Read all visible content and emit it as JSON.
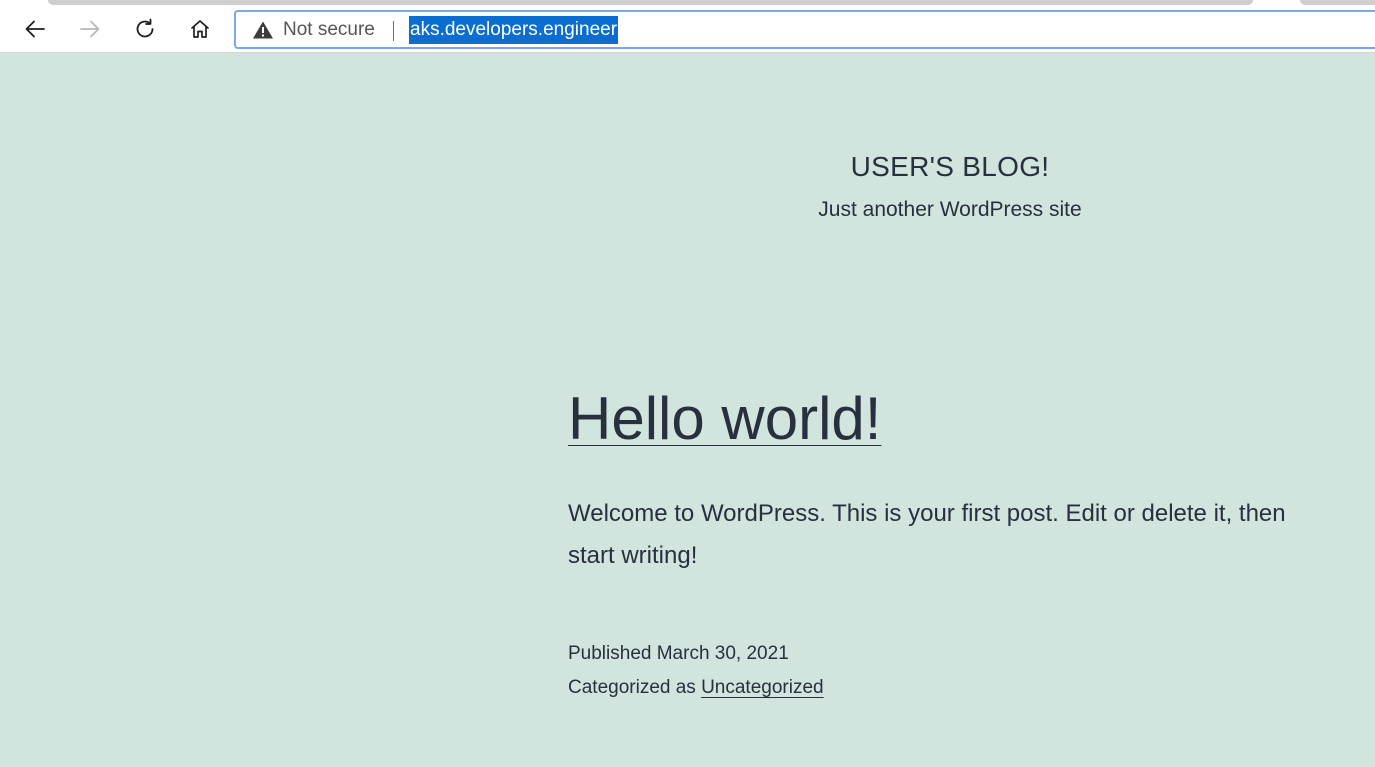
{
  "browser": {
    "back_icon": "arrow-left-icon",
    "forward_icon": "arrow-right-icon",
    "reload_icon": "reload-icon",
    "home_icon": "home-icon",
    "security_icon": "warning-triangle-icon",
    "security_label": "Not secure",
    "url": "aks.developers.engineer",
    "url_selected": true,
    "selection_color": "#0a6ed1",
    "focus_ring_color": "#7aa7e6"
  },
  "site": {
    "title": "USER'S BLOG!",
    "description": "Just another WordPress site",
    "background_color": "#d1e4dd",
    "text_color": "#28303d"
  },
  "post": {
    "title": "Hello world!",
    "excerpt": "Welcome to WordPress. This is your first post. Edit or delete it, then start writing!",
    "published_label": "Published",
    "published_date": "March 30, 2021",
    "category_label": "Categorized as",
    "category": "Uncategorized"
  }
}
